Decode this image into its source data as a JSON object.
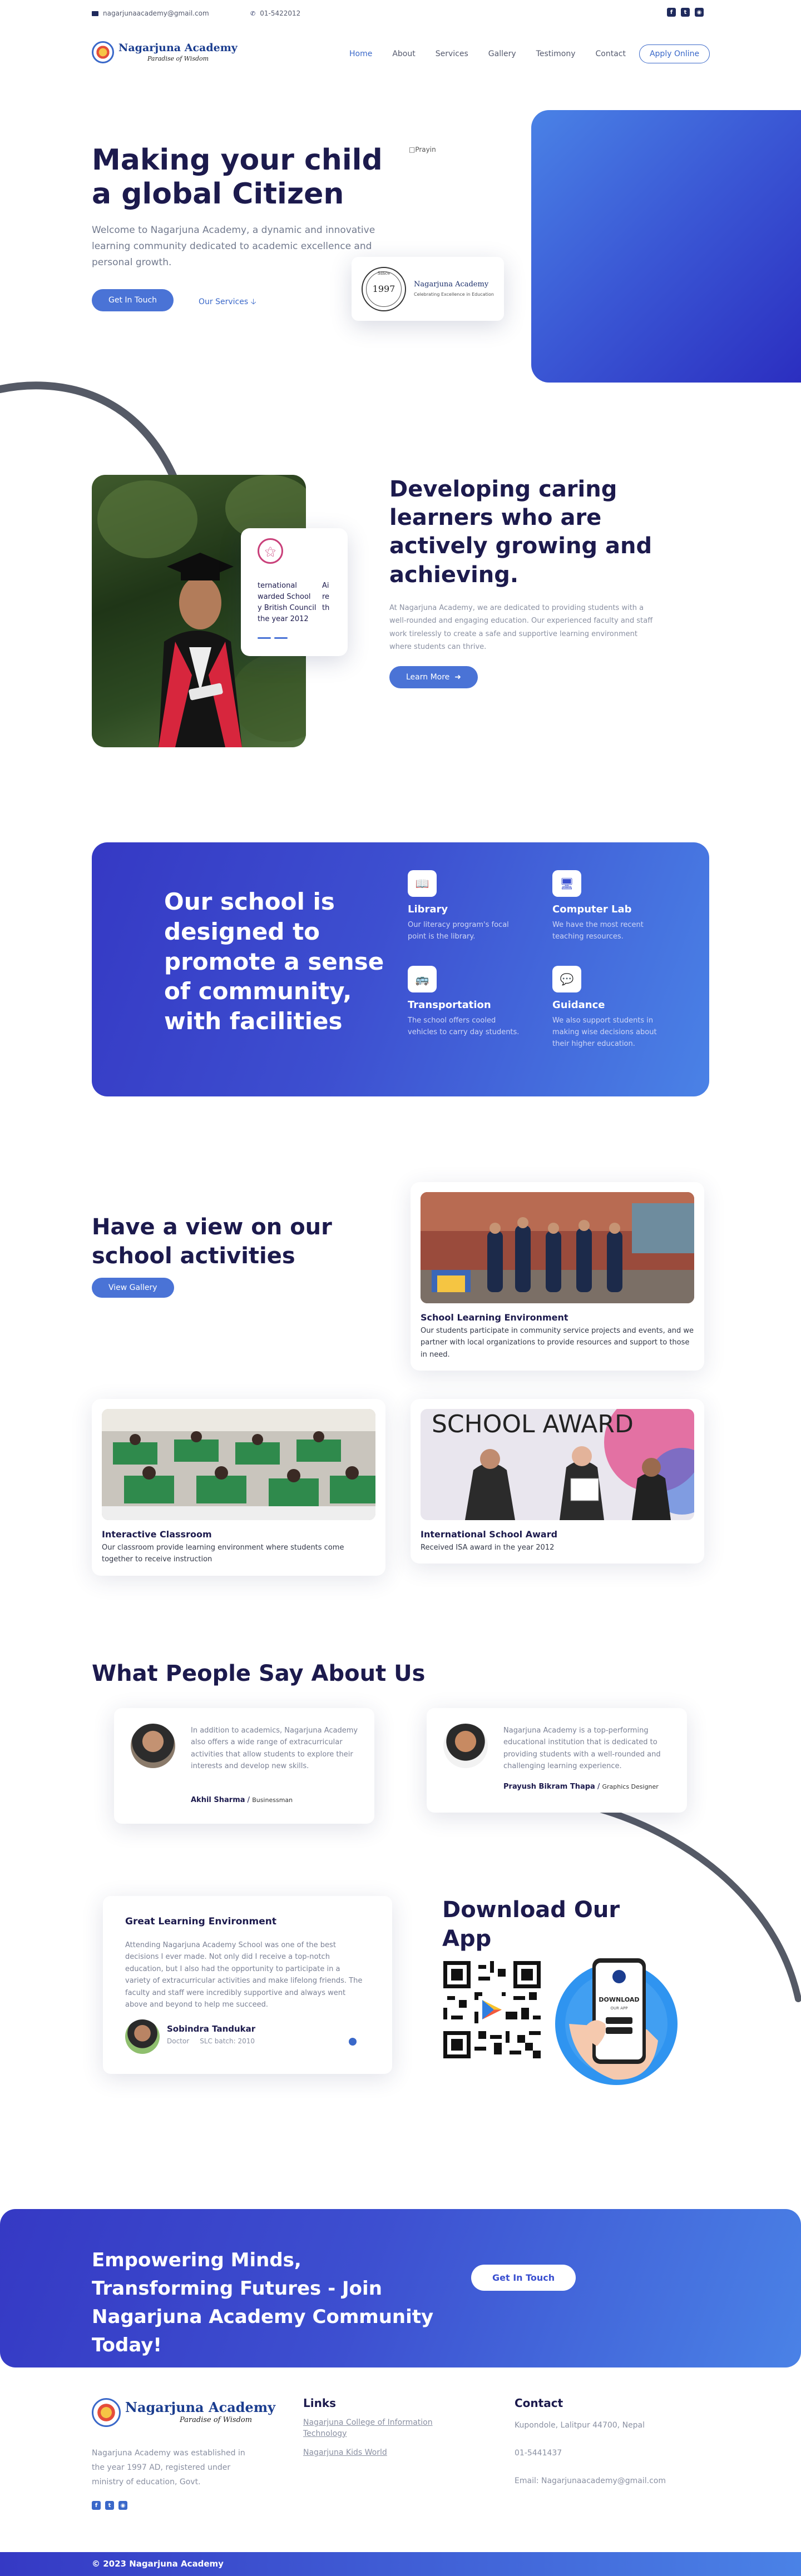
{
  "topbar": {
    "email": "nagarjunaacademy@gmail.com",
    "phone": "01-5422012",
    "social": [
      "facebook-icon",
      "twitter-icon",
      "instagram-icon"
    ]
  },
  "brand": {
    "name": "Nagarjuna Academy",
    "tagline": "Paradise of Wisdom"
  },
  "nav": {
    "items": [
      "Home",
      "About",
      "Services",
      "Gallery",
      "Testimony",
      "Contact"
    ],
    "active": "Home",
    "apply": "Apply Online"
  },
  "hero": {
    "title": "Making your child a global Citizen",
    "subtitle": "Welcome to Nagarjuna Academy, a dynamic and innovative learning community dedicated to academic excellence and personal growth.",
    "cta_primary": "Get In Touch",
    "cta_secondary": "Our Services",
    "broken_image_alt": "Prayin",
    "seal": {
      "since": "Since",
      "year": "1997",
      "name": "Nagarjuna Academy",
      "line": "Celebrating Excellence in Education"
    }
  },
  "about": {
    "float_card_text_left": [
      "ternational",
      "warded School",
      "y British Council",
      "the year 2012"
    ],
    "float_card_text_right": [
      "Ai",
      "re",
      "th"
    ],
    "title": "Developing caring learners who are actively growing and achieving.",
    "text": "At Nagarjuna Academy, we are dedicated to providing students with a well-rounded and engaging education. Our experienced faculty and staff work tirelessly to create a safe and supportive learning environment where students can thrive.",
    "button": "Learn More"
  },
  "facilities": {
    "title": "Our school is designed to promote a sense of community, with facilities",
    "items": [
      {
        "icon": "book-icon",
        "name": "Library",
        "desc": "Our literacy program's focal point is the library."
      },
      {
        "icon": "monitor-icon",
        "name": "Computer Lab",
        "desc": "We have the most recent teaching resources."
      },
      {
        "icon": "bus-icon",
        "name": "Transportation",
        "desc": "The school offers cooled vehicles to carry day students."
      },
      {
        "icon": "guidance-icon",
        "name": "Guidance",
        "desc": "We also support students in making wise decisions about their higher education."
      }
    ]
  },
  "gallery": {
    "title": "Have a view on our school activities",
    "button": "View Gallery",
    "cards": [
      {
        "title": "School Learning Environment",
        "desc": "Our students participate in community service projects and events, and we partner with local organizations to provide resources and support to those in need."
      },
      {
        "title": "Interactive Classroom",
        "desc": "Our classroom provide learning environment where students come together to receive instruction"
      },
      {
        "title": "International School Award",
        "desc": "Received ISA award in the year 2012",
        "banner": "SCHOOL AWARD"
      }
    ]
  },
  "testimonials": {
    "title": "What People Say About Us",
    "items": [
      {
        "quote": "In addition to academics, Nagarjuna Academy also offers a wide range of extracurricular activities that allow students to explore their interests and develop new skills.",
        "name": "Akhil Sharma",
        "role": "Businessman"
      },
      {
        "quote": "Nagarjuna Academy is a top-performing educational institution that is dedicated to providing students with a well-rounded and challenging learning experience.",
        "name": "Prayush Bikram Thapa",
        "role": "Graphics Designer"
      },
      {
        "heading": "Great Learning Environment",
        "quote": "Attending Nagarjuna Academy School was one of the best decisions I ever made. Not only did I receive a top-notch education, but I also had the opportunity to participate in a variety of extracurricular activities and make lifelong friends. The faculty and staff were incredibly supportive and always went above and beyond to help me succeed.",
        "name": "Sobindra Tandukar",
        "role": "Doctor",
        "batch": "SLC batch: 2010"
      }
    ]
  },
  "app": {
    "title": "Download Our App",
    "phone_label": "DOWNLOAD",
    "phone_sub": "OUR APP"
  },
  "cta": {
    "text": "Empowering Minds, Transforming Futures - Join Nagarjuna Academy Community Today!",
    "button": "Get In Touch"
  },
  "footer": {
    "about": "Nagarjuna Academy was established in the year 1997 AD, registered under ministry of education, Govt.",
    "links_title": "Links",
    "links": [
      "Nagarjuna College of Information Technology",
      "Nagarjuna Kids World"
    ],
    "contact_title": "Contact",
    "address": "Kupondole, Lalitpur 44700, Nepal",
    "phone": "01-5441437",
    "email": "Email: Nagarjunaacademy@gmail.com",
    "copyright": "© 2023 Nagarjuna Academy"
  },
  "colors": {
    "accent": "#4a73d6",
    "navy": "#1c1a4d",
    "gradient_start": "#3539c4",
    "gradient_end": "#4a82e6"
  }
}
